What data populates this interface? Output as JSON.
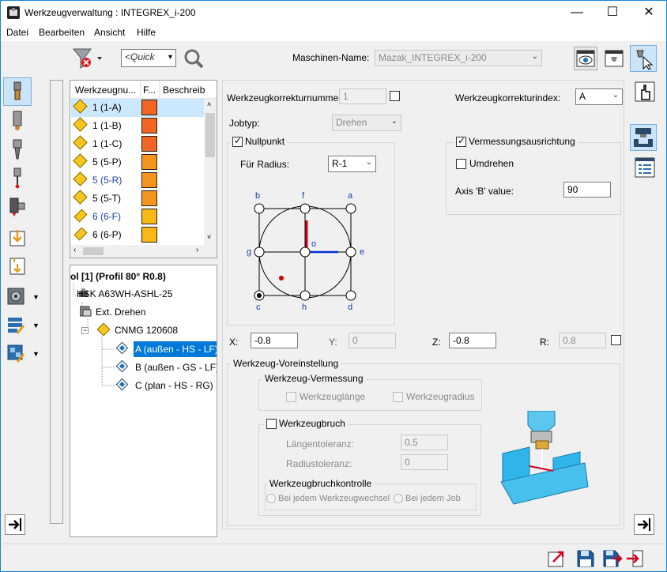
{
  "window": {
    "title": "Werkzeugverwaltung : INTEGREX_i-200",
    "minimize": "—",
    "maximize": "☐",
    "close": "✕"
  },
  "menu": [
    "Datei",
    "Bearbeiten",
    "Ansicht",
    "Hilfe"
  ],
  "toolbar": {
    "quick_placeholder": "<Quick",
    "machine_label": "Maschinen-Name:",
    "machine_value": "Mazak_INTEGREX_i-200"
  },
  "tool_list": {
    "headers": [
      "Werkzeugnu...",
      "F...",
      "Beschreib"
    ],
    "rows": [
      {
        "label": "1 (1-A)",
        "color": "#f26522",
        "selected": true,
        "blue": false
      },
      {
        "label": "1 (1-B)",
        "color": "#f26522",
        "selected": false,
        "blue": false
      },
      {
        "label": "1 (1-C)",
        "color": "#f26522",
        "selected": false,
        "blue": false
      },
      {
        "label": "5 (5-P)",
        "color": "#f7941d",
        "selected": false,
        "blue": false
      },
      {
        "label": "5 (5-R)",
        "color": "#f7941d",
        "selected": false,
        "blue": true
      },
      {
        "label": "5 (5-T)",
        "color": "#f7941d",
        "selected": false,
        "blue": false
      },
      {
        "label": "6 (6-F)",
        "color": "#fbb714",
        "selected": false,
        "blue": true
      },
      {
        "label": "6 (6-P)",
        "color": "#fbb714",
        "selected": false,
        "blue": false
      }
    ]
  },
  "tree": {
    "root": "ol [1] (Profil 80° R0.8)",
    "holder": "HSK A63WH-ASHL-25",
    "ext": "Ext. Drehen",
    "insert": "CNMG 120608",
    "edges": [
      "A (außen - HS - LF)",
      "B (außen - GS - LF)",
      "C (plan - HS - RG)"
    ],
    "tree_toggle": "−"
  },
  "form": {
    "korr_nr_label": "Werkzeugkorrekturnummer:",
    "korr_nr_value": "1",
    "korr_idx_label": "Werkzeugkorrekturindex:",
    "korr_idx_value": "A",
    "jobtyp_label": "Jobtyp:",
    "jobtyp_value": "Drehen",
    "nullpunkt_label": "Nullpunkt",
    "nullpunkt_checked": true,
    "radius_label": "Für Radius:",
    "radius_value": "R-1",
    "grid_labels": {
      "b": "b",
      "f": "f",
      "a": "a",
      "g": "g",
      "o": "o",
      "e": "e",
      "c": "c",
      "h": "h",
      "d": "d"
    },
    "verm_label": "Vermessungsausrichtung",
    "verm_checked": true,
    "umdrehen_label": "Umdrehen",
    "axisb_label": "Axis 'B' value:",
    "axisb_value": "90",
    "x_label": "X:",
    "x_value": "-0.8",
    "y_label": "Y:",
    "y_value": "0",
    "z_label": "Z:",
    "z_value": "-0.8",
    "r_label": "R:",
    "r_value": "0.8",
    "preset_title": "Werkzeug-Voreinstellung",
    "vermessung_title": "Werkzeug-Vermessung",
    "laenge_label": "Werkzeuglänge",
    "radius2_label": "Werkzeugradius",
    "bruch_label": "Werkzeugbruch",
    "laengentol_label": "Längentoleranz:",
    "laengentol_value": "0.5",
    "radiustol_label": "Radiustoleranz:",
    "radiustol_value": "0",
    "kontrolle_title": "Werkzeugbruchkontrolle",
    "radio1": "Bei jedem Werkzeugwechsel",
    "radio2": "Bei jedem Job"
  }
}
